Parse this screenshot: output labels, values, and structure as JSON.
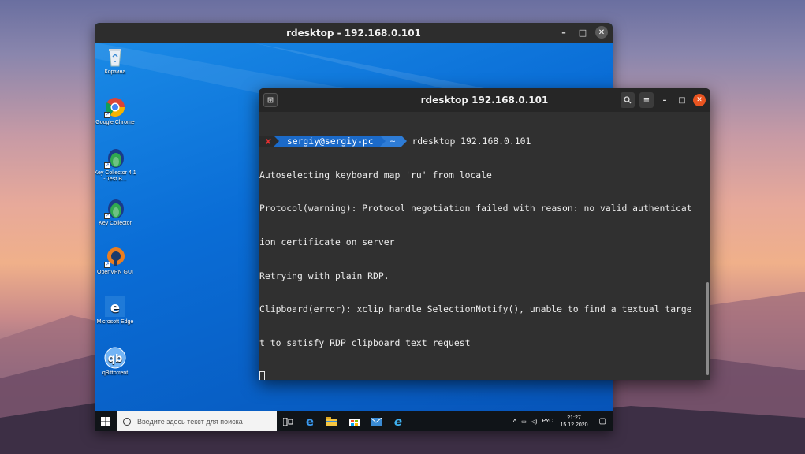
{
  "rdesktop_window": {
    "title": "rdesktop - 192.168.0.101",
    "controls": {
      "minimize": "–",
      "maximize": "□",
      "close": "✕"
    }
  },
  "desktop_icons": [
    {
      "label": "Корзина",
      "icon": "recycle-bin-icon"
    },
    {
      "label": "Google Chrome",
      "icon": "chrome-icon"
    },
    {
      "label": "Key Collector 4.1 - Test B...",
      "icon": "key-collector-icon"
    },
    {
      "label": "Key Collector",
      "icon": "key-collector-icon"
    },
    {
      "label": "OpenVPN GUI",
      "icon": "openvpn-icon"
    },
    {
      "label": "Microsoft Edge",
      "icon": "edge-icon"
    },
    {
      "label": "qBittorrent",
      "icon": "qbittorrent-icon"
    }
  ],
  "win_taskbar": {
    "search_placeholder": "Введите здесь текст для поиска",
    "tray_lang": "РУС",
    "time": "21:27",
    "date": "15.12.2020"
  },
  "terminal": {
    "title": "rdesktop 192.168.0.101",
    "prompt": {
      "status": "✘",
      "user_host": "sergiy@sergiy-pc",
      "dir": "~",
      "command": "rdesktop 192.168.0.101"
    },
    "output": [
      "Autoselecting keyboard map 'ru' from locale",
      "Protocol(warning): Protocol negotiation failed with reason: no valid authenticat",
      "ion certificate on server",
      "Retrying with plain RDP.",
      "Clipboard(error): xclip_handle_SelectionNotify(), unable to find a textual targe",
      "t to satisfy RDP clipboard text request"
    ]
  },
  "colors": {
    "terminal_bg": "#303030",
    "win_desktop": "#0a6fd1",
    "ubuntu_orange": "#e95420",
    "prompt_blue": "#1b6ac9"
  }
}
